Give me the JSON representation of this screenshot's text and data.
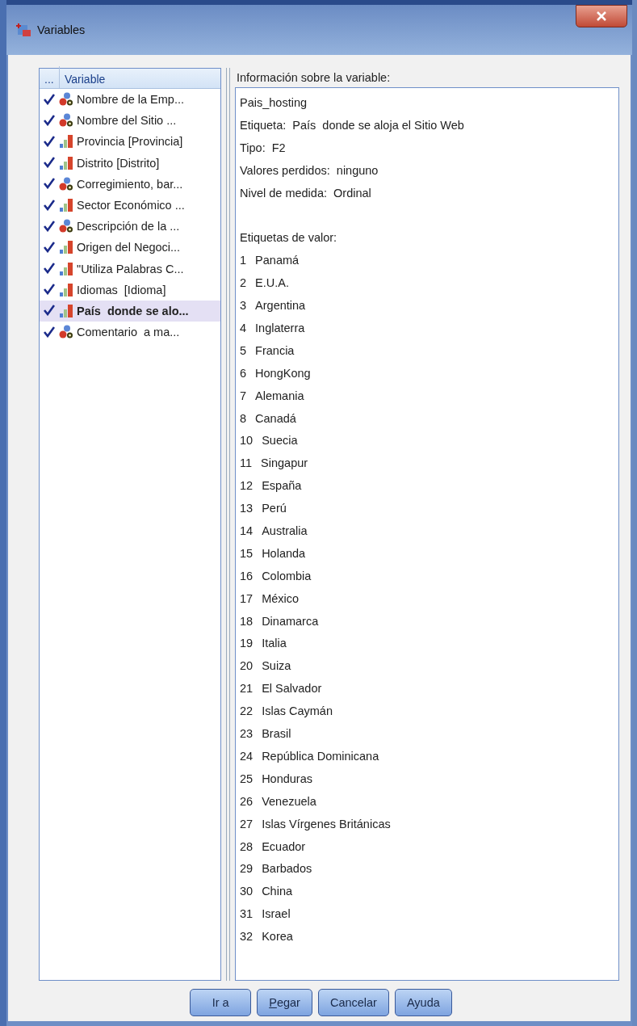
{
  "window": {
    "title": "Variables"
  },
  "variable_list": {
    "columns": [
      "...",
      "Variable"
    ],
    "items": [
      {
        "label": "Nombre de la Emp...",
        "kind": "nominal",
        "checked": true,
        "selected": false
      },
      {
        "label": "Nombre del Sitio ...",
        "kind": "nominal",
        "checked": true,
        "selected": false
      },
      {
        "label": "Provincia [Provincia]",
        "kind": "ordinal",
        "checked": true,
        "selected": false
      },
      {
        "label": "Distrito [Distrito]",
        "kind": "ordinal",
        "checked": true,
        "selected": false
      },
      {
        "label": "Corregimiento, bar...",
        "kind": "nominal",
        "checked": true,
        "selected": false
      },
      {
        "label": "Sector Económico ...",
        "kind": "ordinal",
        "checked": true,
        "selected": false
      },
      {
        "label": "Descripción de la ...",
        "kind": "nominal",
        "checked": true,
        "selected": false
      },
      {
        "label": "Origen del Negoci...",
        "kind": "ordinal",
        "checked": true,
        "selected": false
      },
      {
        "label": "\"Utiliza Palabras C...",
        "kind": "ordinal",
        "checked": true,
        "selected": false
      },
      {
        "label": "Idiomas  [Idioma]",
        "kind": "ordinal",
        "checked": true,
        "selected": false
      },
      {
        "label": "País  donde se alo...",
        "kind": "ordinal",
        "checked": true,
        "selected": true
      },
      {
        "label": "Comentario  a ma...",
        "kind": "nominal",
        "checked": true,
        "selected": false
      }
    ]
  },
  "info": {
    "heading": "Información sobre la variable:",
    "lines": [
      "Pais_hosting",
      "Etiqueta:  País  donde se aloja el Sitio Web",
      "Tipo:  F2",
      "Valores perdidos:  ninguno",
      "Nivel de medida:  Ordinal"
    ],
    "value_labels_heading": "Etiquetas de valor:",
    "value_labels": [
      {
        "value": "1",
        "label": "Panamá"
      },
      {
        "value": "2",
        "label": "E.U.A."
      },
      {
        "value": "3",
        "label": "Argentina"
      },
      {
        "value": "4",
        "label": "Inglaterra"
      },
      {
        "value": "5",
        "label": "Francia"
      },
      {
        "value": "6",
        "label": "HongKong"
      },
      {
        "value": "7",
        "label": "Alemania"
      },
      {
        "value": "8",
        "label": "Canadá"
      },
      {
        "value": "10",
        "label": "Suecia"
      },
      {
        "value": "11",
        "label": "Singapur"
      },
      {
        "value": "12",
        "label": "España"
      },
      {
        "value": "13",
        "label": "Perú"
      },
      {
        "value": "14",
        "label": "Australia"
      },
      {
        "value": "15",
        "label": "Holanda"
      },
      {
        "value": "16",
        "label": "Colombia"
      },
      {
        "value": "17",
        "label": "México"
      },
      {
        "value": "18",
        "label": "Dinamarca"
      },
      {
        "value": "19",
        "label": "Italia"
      },
      {
        "value": "20",
        "label": "Suiza"
      },
      {
        "value": "21",
        "label": "El Salvador"
      },
      {
        "value": "22",
        "label": "Islas Caymán"
      },
      {
        "value": "23",
        "label": "Brasil"
      },
      {
        "value": "24",
        "label": "República Dominicana"
      },
      {
        "value": "25",
        "label": "Honduras"
      },
      {
        "value": "26",
        "label": "Venezuela"
      },
      {
        "value": "27",
        "label": "Islas Vírgenes Británicas"
      },
      {
        "value": "28",
        "label": "Ecuador"
      },
      {
        "value": "29",
        "label": "Barbados"
      },
      {
        "value": "30",
        "label": "China"
      },
      {
        "value": "31",
        "label": "Israel"
      },
      {
        "value": "32",
        "label": "Korea"
      }
    ]
  },
  "buttons": [
    {
      "label": "Ir a",
      "underline_first": false
    },
    {
      "label": "Pegar",
      "underline_first": true
    },
    {
      "label": "Cancelar",
      "underline_first": false
    },
    {
      "label": "Ayuda",
      "underline_first": false
    }
  ]
}
